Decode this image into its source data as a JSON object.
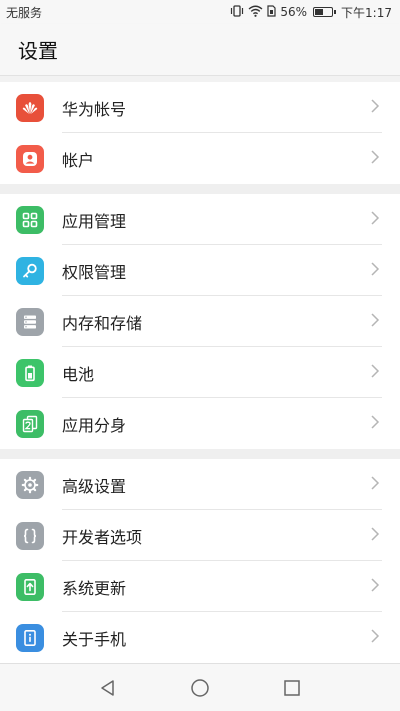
{
  "status_bar": {
    "carrier": "无服务",
    "battery_level": "56%",
    "time": "下午1:17",
    "battery_fraction": 0.56,
    "icons": [
      "vibrate-icon",
      "wifi-icon",
      "sim-icon",
      "battery-icon"
    ]
  },
  "header": {
    "title": "设置"
  },
  "groups": [
    {
      "items": [
        {
          "label": "华为帐号",
          "icon": "huawei-logo-icon",
          "color": "#e8503a"
        },
        {
          "label": "帐户",
          "icon": "account-icon",
          "color": "#f25c4a"
        }
      ]
    },
    {
      "items": [
        {
          "label": "应用管理",
          "icon": "app-grid-icon",
          "color": "#3dbd66"
        },
        {
          "label": "权限管理",
          "icon": "key-icon",
          "color": "#2fb3e2"
        },
        {
          "label": "内存和存储",
          "icon": "storage-icon",
          "color": "#9ea4aa"
        },
        {
          "label": "电池",
          "icon": "battery-icon",
          "color": "#3dc46a"
        },
        {
          "label": "应用分身",
          "icon": "app-twin-icon",
          "color": "#3dbd66"
        }
      ]
    },
    {
      "items": [
        {
          "label": "高级设置",
          "icon": "gear-icon",
          "color": "#9ea4aa"
        },
        {
          "label": "开发者选项",
          "icon": "braces-icon",
          "color": "#9ea4aa"
        },
        {
          "label": "系统更新",
          "icon": "update-icon",
          "color": "#3dbd66"
        },
        {
          "label": "关于手机",
          "icon": "info-icon",
          "color": "#3a8ee0"
        }
      ]
    }
  ],
  "nav_bar": {
    "icons": [
      "back-icon",
      "home-icon",
      "recents-icon"
    ]
  }
}
